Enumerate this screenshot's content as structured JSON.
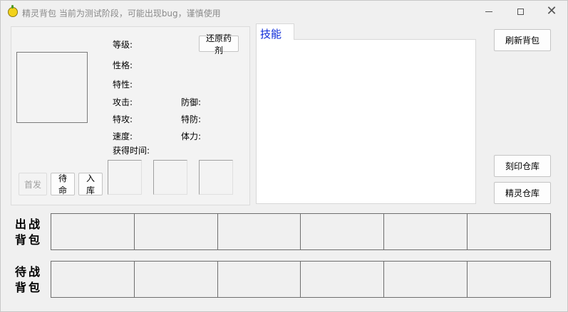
{
  "window": {
    "title": "精灵背包 当前为测试阶段，可能出现bug，谨慎使用"
  },
  "info": {
    "level_label": "等级:",
    "nature_label": "性格:",
    "trait_label": "特性:",
    "attack_label": "攻击:",
    "defense_label": "防御:",
    "sp_attack_label": "特攻:",
    "sp_defense_label": "特防:",
    "speed_label": "速度:",
    "hp_label": "体力:",
    "obtained_time_label": "获得时间:",
    "restore_potion_label": "还原药剂",
    "first_label": "首发",
    "standby_label": "待命",
    "store_label": "入库"
  },
  "skills": {
    "tab_label": "技能"
  },
  "side_buttons": {
    "refresh_bag_label": "刷新背包",
    "imprint_warehouse_label": "刻印仓库",
    "pet_warehouse_label": "精灵仓库"
  },
  "bags": {
    "battle_label_line1": "出战",
    "battle_label_line2": "背包",
    "standby_label_line1": "待战",
    "standby_label_line2": "背包"
  }
}
